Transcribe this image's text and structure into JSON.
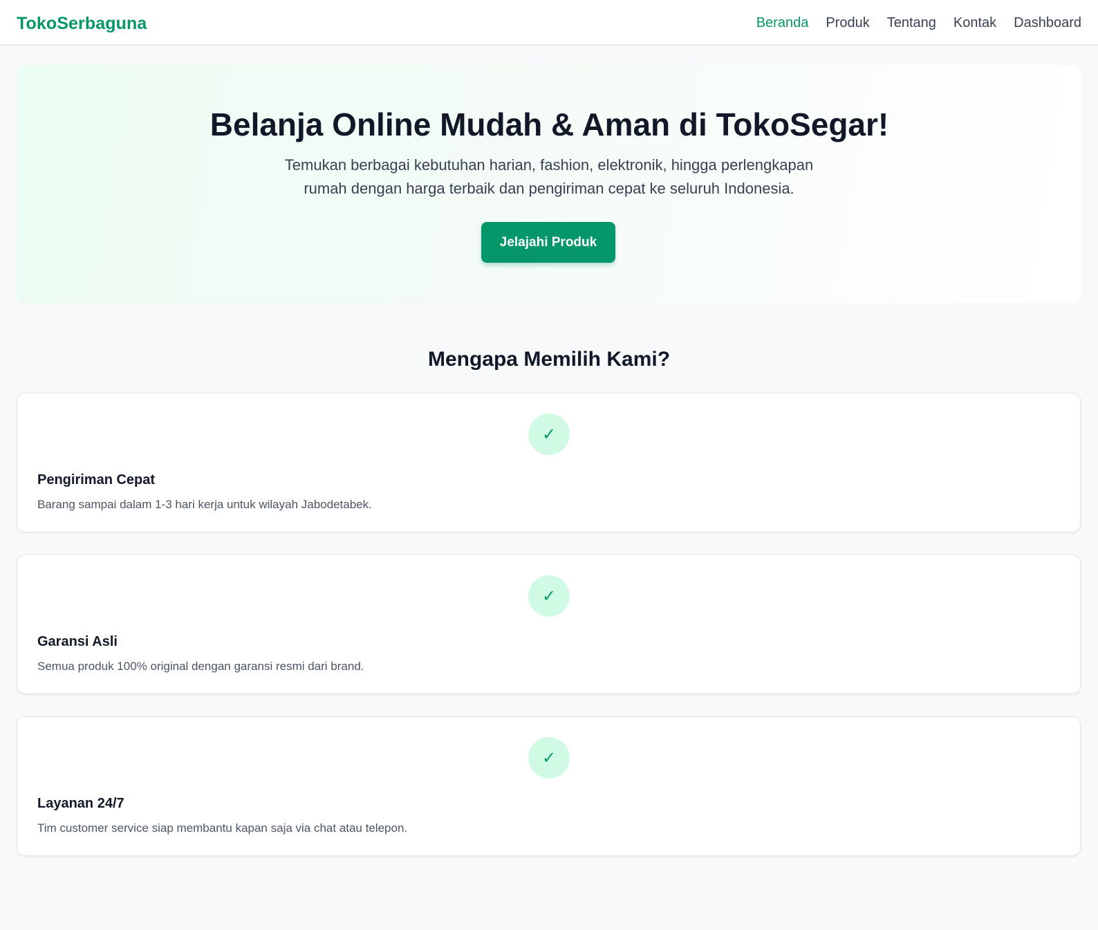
{
  "header": {
    "brand": "TokoSerbaguna",
    "nav": [
      {
        "label": "Beranda",
        "active": true
      },
      {
        "label": "Produk",
        "active": false
      },
      {
        "label": "Tentang",
        "active": false
      },
      {
        "label": "Kontak",
        "active": false
      },
      {
        "label": "Dashboard",
        "active": false
      }
    ]
  },
  "hero": {
    "title": "Belanja Online Mudah & Aman di TokoSegar!",
    "description": "Temukan berbagai kebutuhan harian, fashion, elektronik, hingga perlengkapan rumah dengan harga terbaik dan pengiriman cepat ke seluruh Indonesia.",
    "cta_label": "Jelajahi Produk"
  },
  "features": {
    "title": "Mengapa Memilih Kami?",
    "items": [
      {
        "icon": "check-icon",
        "glyph": "✓",
        "title": "Pengiriman Cepat",
        "description": "Barang sampai dalam 1-3 hari kerja untuk wilayah Jabodetabek."
      },
      {
        "icon": "check-icon",
        "glyph": "✓",
        "title": "Garansi Asli",
        "description": "Semua produk 100% original dengan garansi resmi dari brand."
      },
      {
        "icon": "check-icon",
        "glyph": "✓",
        "title": "Layanan 24/7",
        "description": "Tim customer service siap membantu kapan saja via chat atau telepon."
      }
    ]
  },
  "colors": {
    "accent": "#059669",
    "badge_bg": "#d1fae5",
    "text_dark": "#111827",
    "text_muted": "#4b5563",
    "page_bg": "#f8f9fb"
  }
}
